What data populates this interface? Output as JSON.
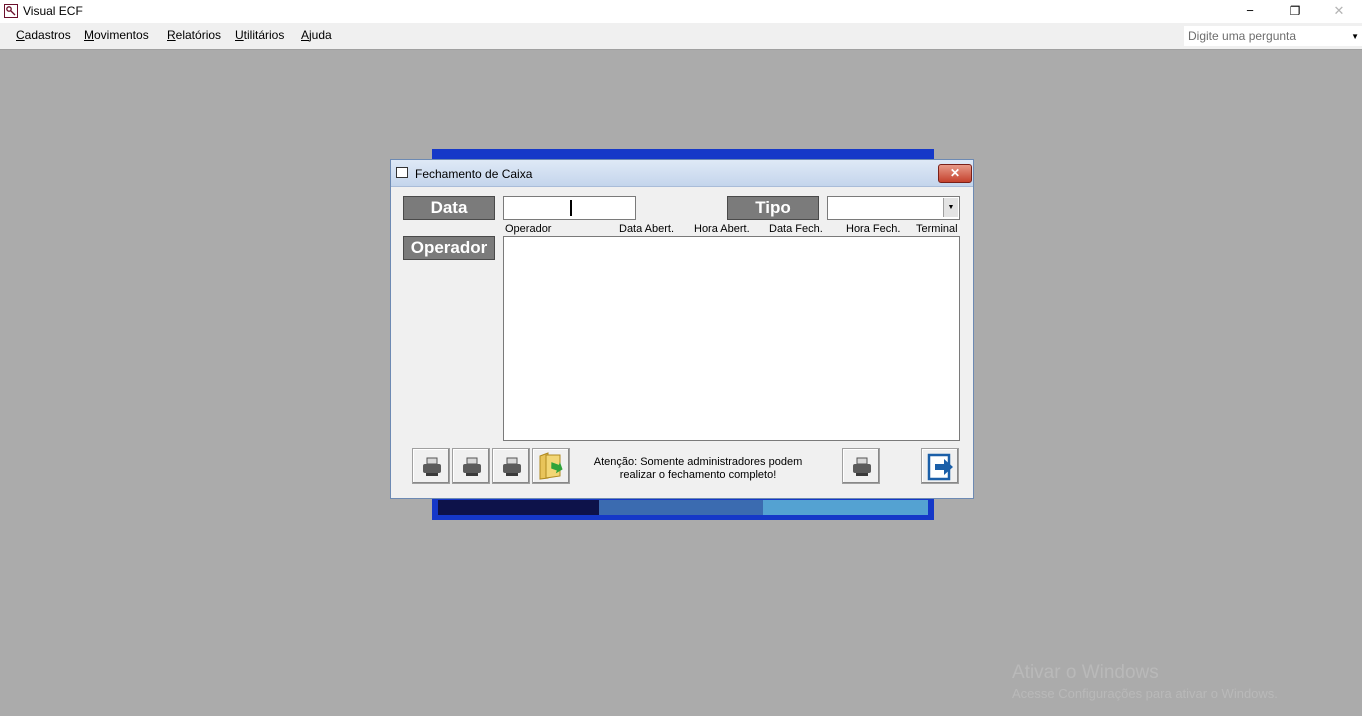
{
  "window": {
    "title": "Visual ECF",
    "minimize": "−",
    "restore": "❐",
    "close": "✕"
  },
  "menu": {
    "items": [
      {
        "accel": "C",
        "rest": "adastros"
      },
      {
        "accel": "M",
        "rest": "ovimentos"
      },
      {
        "accel": "R",
        "rest": "elatórios"
      },
      {
        "accel": "U",
        "rest": "tilitários"
      },
      {
        "accel": "A",
        "rest": "juda"
      }
    ],
    "ask_placeholder": "Digite uma pergunta",
    "ask_arrow": "▼"
  },
  "splash": {
    "bar_colors": [
      "#0d124a",
      "#3b6bb0",
      "#54a2d2"
    ]
  },
  "dialog": {
    "title": "Fechamento de Caixa",
    "close": "✕",
    "data_label": "Data",
    "tipo_label": "Tipo",
    "operador_label": "Operador",
    "data_value": "",
    "tipo_value": "",
    "tipo_arrow": "▼",
    "columns": [
      "Operador",
      "Data Abert.",
      "Hora Abert.",
      "Data Fech.",
      "Hora Fech.",
      "Terminal"
    ],
    "notice_line1": "Atenção: Somente administradores podem",
    "notice_line2": "realizar o fechamento completo!"
  },
  "watermark": {
    "line1": "Ativar o Windows",
    "line2": "Acesse Configurações para ativar o Windows."
  }
}
